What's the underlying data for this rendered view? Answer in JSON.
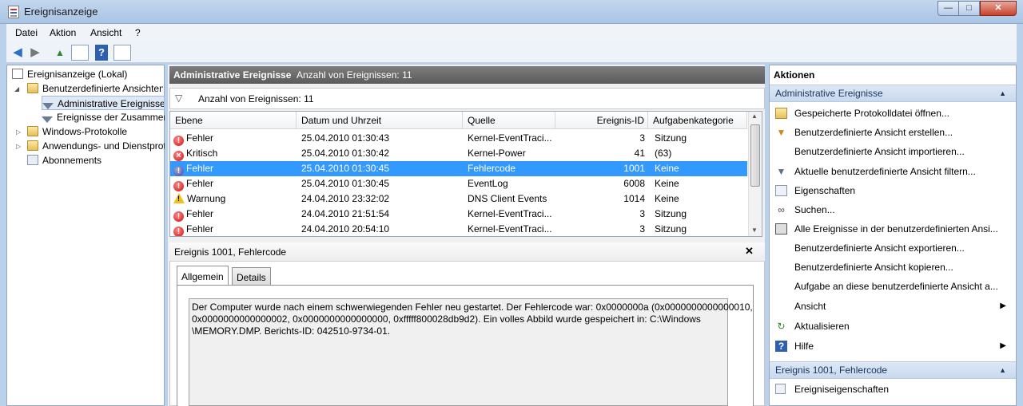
{
  "window": {
    "title": "Ereignisanzeige",
    "min": "—",
    "max": "□",
    "close": "✕"
  },
  "menu": [
    "Datei",
    "Aktion",
    "Ansicht",
    "?"
  ],
  "toolbar": {
    "back": "◀",
    "forward": "▶",
    "up": "▲",
    "help": "?"
  },
  "tree": {
    "root": "Ereignisanzeige (Lokal)",
    "custom_views": "Benutzerdefinierte Ansichten",
    "admin_events": "Administrative Ereignisse",
    "summary_events": "Ereignisse der Zusammenfassung",
    "windows_logs": "Windows-Protokolle",
    "app_logs": "Anwendungs- und Dienstprotokolle",
    "subscriptions": "Abonnements"
  },
  "center": {
    "title": "Administrative Ereignisse",
    "count_label": "Anzahl von Ereignissen: 11",
    "filter_text": "Anzahl von Ereignissen: 11"
  },
  "grid": {
    "columns": [
      "Ebene",
      "Datum und Uhrzeit",
      "Quelle",
      "Ereignis-ID",
      "Aufgabenkategorie"
    ],
    "rows": [
      {
        "level": "Fehler",
        "date": "25.04.2010 01:30:43",
        "source": "Kernel-EventTraci...",
        "id": "3",
        "category": "Sitzung",
        "type": "err"
      },
      {
        "level": "Kritisch",
        "date": "25.04.2010 01:30:42",
        "source": "Kernel-Power",
        "id": "41",
        "category": "(63)",
        "type": "crit"
      },
      {
        "level": "Fehler",
        "date": "25.04.2010 01:30:45",
        "source": "Fehlercode",
        "id": "1001",
        "category": "Keine",
        "type": "err"
      },
      {
        "level": "Fehler",
        "date": "25.04.2010 01:30:45",
        "source": "EventLog",
        "id": "6008",
        "category": "Keine",
        "type": "err"
      },
      {
        "level": "Warnung",
        "date": "24.04.2010 23:32:02",
        "source": "DNS Client Events",
        "id": "1014",
        "category": "Keine",
        "type": "warn"
      },
      {
        "level": "Fehler",
        "date": "24.04.2010 21:51:54",
        "source": "Kernel-EventTraci...",
        "id": "3",
        "category": "Sitzung",
        "type": "err"
      },
      {
        "level": "Fehler",
        "date": "24.04.2010 20:54:10",
        "source": "Kernel-EventTraci...",
        "id": "3",
        "category": "Sitzung",
        "type": "err"
      }
    ],
    "selected_index": 2
  },
  "detail": {
    "title": "Ereignis 1001, Fehlercode",
    "close": "✕",
    "tabs": [
      "Allgemein",
      "Details"
    ],
    "active_tab": "Allgemein",
    "message_line1": "Der Computer wurde nach einem schwerwiegenden Fehler neu gestartet. Der Fehlercode war: 0x0000000a (0x0000000000000010,",
    "message_line2": "0x0000000000000002, 0x0000000000000000, 0xfffff800028db9d2). Ein volles Abbild wurde gespeichert in: C:\\Windows",
    "message_line3": "\\MEMORY.DMP. Berichts-ID: 042510-9734-01."
  },
  "actions": {
    "title": "Aktionen",
    "section1": "Administrative Ereignisse",
    "items1": [
      "Gespeicherte Protokolldatei öffnen...",
      "Benutzerdefinierte Ansicht erstellen...",
      "Benutzerdefinierte Ansicht importieren...",
      "Aktuelle benutzerdefinierte Ansicht filtern...",
      "Eigenschaften",
      "Suchen...",
      "Alle Ereignisse in der benutzerdefinierten Ansi...",
      "Benutzerdefinierte Ansicht exportieren...",
      "Benutzerdefinierte Ansicht kopieren...",
      "Aufgabe an diese benutzerdefinierte Ansicht a...",
      "Ansicht",
      "Aktualisieren",
      "Hilfe"
    ],
    "section2": "Ereignis 1001, Fehlercode",
    "items2": [
      "Ereigniseigenschaften"
    ]
  }
}
